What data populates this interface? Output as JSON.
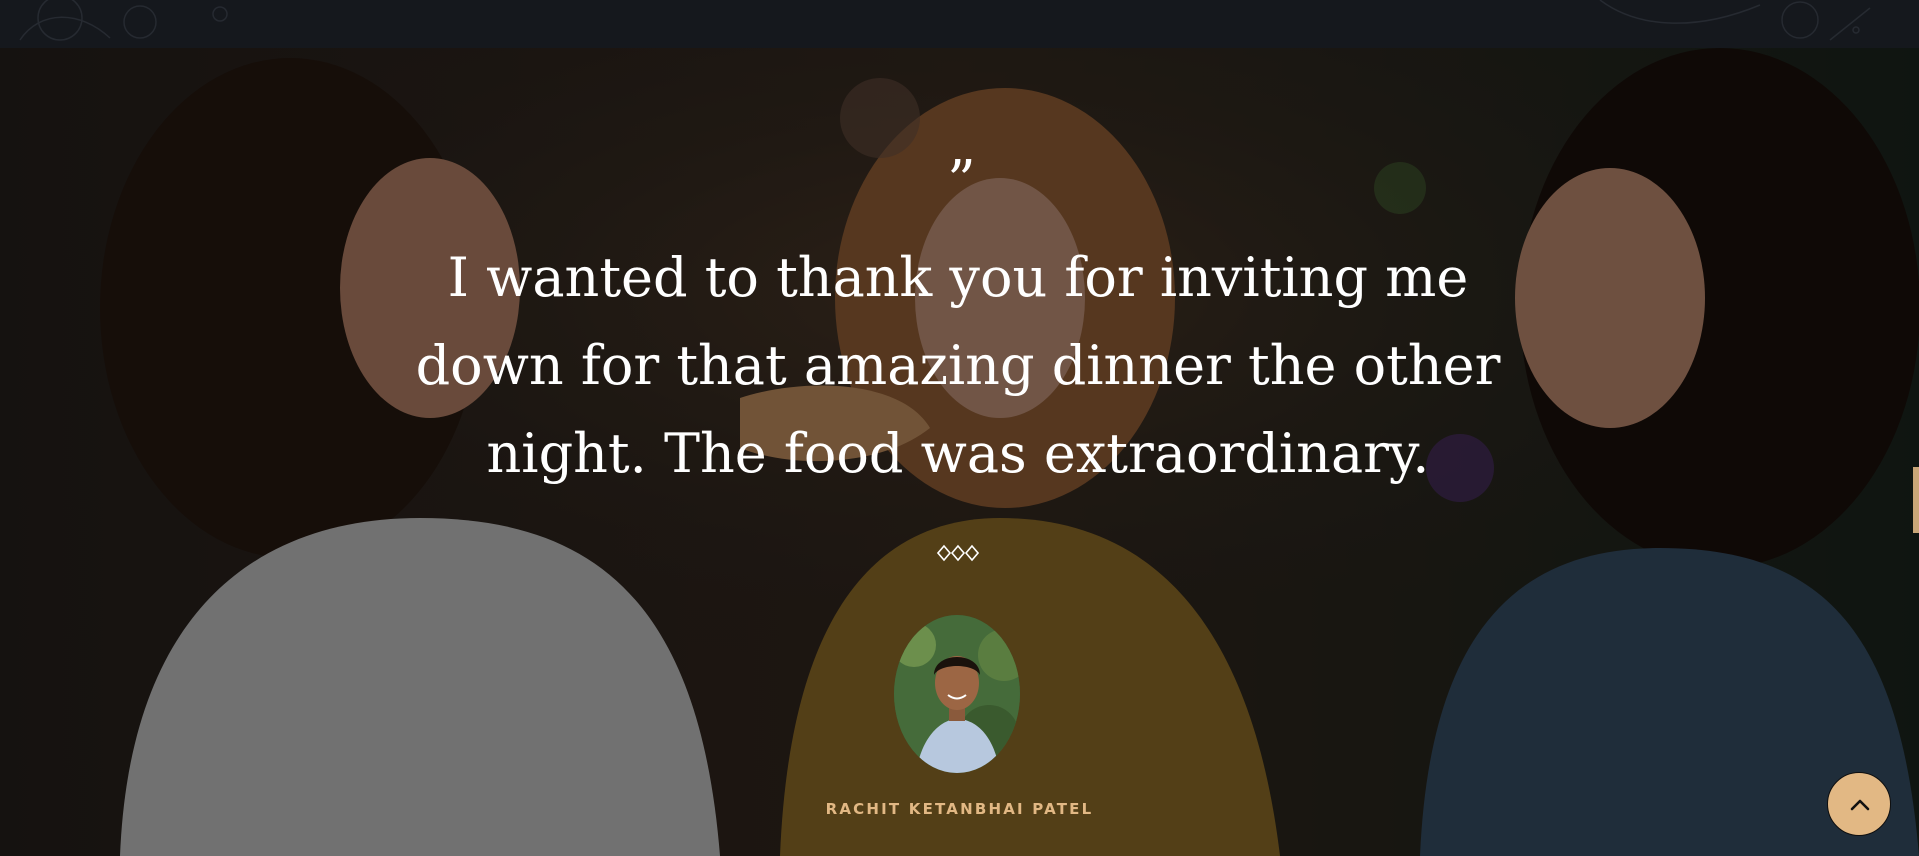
{
  "testimonial": {
    "quote_mark": "”",
    "quote": "I wanted to thank you for inviting me down for that amazing dinner the other night. The food was extraordinary.",
    "author": "RACHIT KETANBHAI PATEL"
  },
  "icons": {
    "divider": "diamond-separator-icon",
    "back_to_top": "chevron-up-icon"
  },
  "colors": {
    "accent": "#e2b884",
    "text": "#ffffff",
    "header_bg": "#15181d"
  }
}
